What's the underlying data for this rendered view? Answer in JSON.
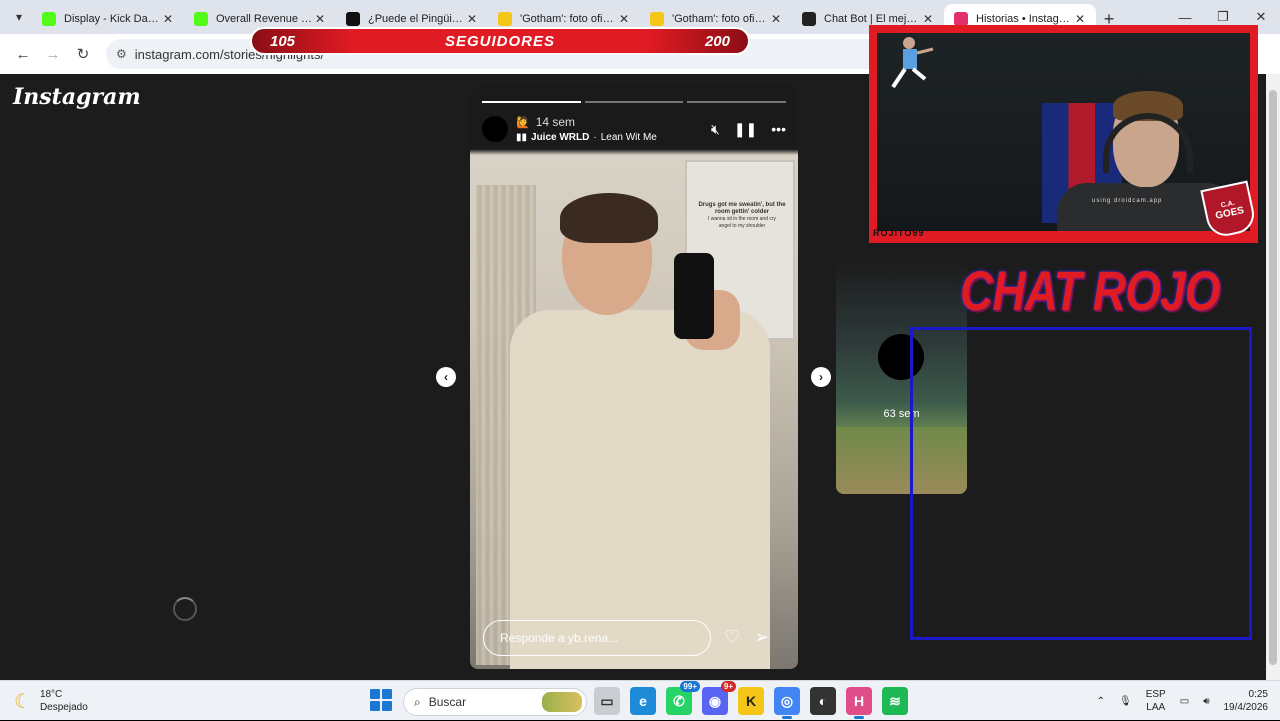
{
  "browser": {
    "tabs": [
      {
        "title": "Display - Kick Dashb",
        "favicon": "kick-icon",
        "color": "#53fc18",
        "active": false
      },
      {
        "title": "Overall Revenue - Ki",
        "favicon": "kick-icon",
        "color": "#53fc18",
        "active": false
      },
      {
        "title": "¿Puede el Pingüino c",
        "favicon": "screenrant-icon",
        "color": "#111111",
        "active": false
      },
      {
        "title": "'Gotham': foto oficial",
        "favicon": "star-icon",
        "color": "#f5c518",
        "active": false
      },
      {
        "title": "'Gotham': foto oficial",
        "favicon": "star-icon",
        "color": "#f5c518",
        "active": false
      },
      {
        "title": "Chat Bot | El mejor s",
        "favicon": "botrix-icon",
        "color": "#222222",
        "active": false
      },
      {
        "title": "Historias • Instagram",
        "favicon": "instagram-icon",
        "color": "#e1306c",
        "active": true
      }
    ],
    "url": "instagram.com/stories/highlights/"
  },
  "overlay": {
    "followers_current": "105",
    "followers_label": "SEGUIDORES",
    "followers_goal": "200",
    "cam_name": "ROJITO99",
    "cam_watermark": "using droidcam.app",
    "badge_line1": "C.A.",
    "badge_line2": "GOES",
    "chat_title": "CHAT ROJO",
    "brand_red": "#e01b24",
    "chat_border": "#1a18c8"
  },
  "instagram": {
    "logo": "Instagram",
    "story": {
      "time": "14 sem",
      "emoji": "🙋",
      "music_artist": "Juice WRLD",
      "music_sep": " · ",
      "music_song": "Lean Wit Me",
      "cabinet_text_1": "Drugs got me sweatin', but the room gettin' colder",
      "cabinet_text_2": "I wanna sit in the room and cry",
      "cabinet_text_3": "angel to my shoulder",
      "reply_placeholder": "Responde a yb.rena..."
    },
    "next_story": {
      "time": "63 sem"
    }
  },
  "taskbar": {
    "temperature": "18°C",
    "weather": "Despejado",
    "search_placeholder": "Buscar",
    "whatsapp_badge": "99+",
    "discord_badge": "9+",
    "lang_1": "ESP",
    "lang_2": "LAA",
    "time": "0:25",
    "date": "19/4/2026"
  }
}
